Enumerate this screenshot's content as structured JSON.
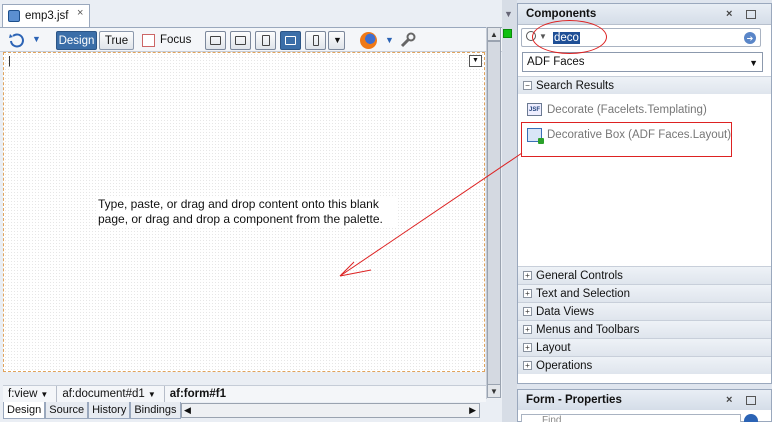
{
  "editor": {
    "tab_title": "emp3.jsf",
    "tab_close": "×",
    "toolbar": {
      "design_label": "Design",
      "true_label": "True",
      "focus_label": "Focus"
    },
    "canvas_message": "Type, paste, or drag and drop content onto this blank page, or drag and drop a component from the palette.",
    "breadcrumb": [
      "f:view",
      "af:document#d1",
      "af:form#f1"
    ],
    "bottom_tabs": [
      "Design",
      "Source",
      "History",
      "Bindings"
    ]
  },
  "components": {
    "title": "Components",
    "search_value": "deco",
    "library": "ADF Faces",
    "search_results_label": "Search Results",
    "results": [
      {
        "label": "Decorate (Facelets.Templating)",
        "icon": "jsf-page-icon"
      },
      {
        "label": "Decorative Box (ADF Faces.Layout)",
        "icon": "decorative-box-icon"
      }
    ],
    "categories": [
      "General Controls",
      "Text and Selection",
      "Data Views",
      "Menus and Toolbars",
      "Layout",
      "Operations"
    ]
  },
  "properties": {
    "title": "Form - Properties",
    "search_placeholder": "Find"
  },
  "colors": {
    "selection": "#1f4f96",
    "annotation": "#dd2222",
    "active_button": "#3b6ea8",
    "canvas_border": "#e0a35c"
  }
}
